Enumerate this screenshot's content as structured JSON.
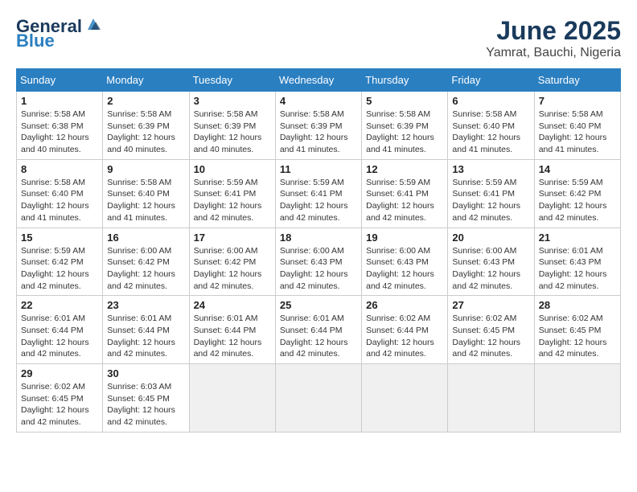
{
  "header": {
    "logo_general": "General",
    "logo_blue": "Blue",
    "month": "June 2025",
    "location": "Yamrat, Bauchi, Nigeria"
  },
  "days_of_week": [
    "Sunday",
    "Monday",
    "Tuesday",
    "Wednesday",
    "Thursday",
    "Friday",
    "Saturday"
  ],
  "weeks": [
    [
      {
        "day": "1",
        "info": "Sunrise: 5:58 AM\nSunset: 6:38 PM\nDaylight: 12 hours\nand 40 minutes."
      },
      {
        "day": "2",
        "info": "Sunrise: 5:58 AM\nSunset: 6:39 PM\nDaylight: 12 hours\nand 40 minutes."
      },
      {
        "day": "3",
        "info": "Sunrise: 5:58 AM\nSunset: 6:39 PM\nDaylight: 12 hours\nand 40 minutes."
      },
      {
        "day": "4",
        "info": "Sunrise: 5:58 AM\nSunset: 6:39 PM\nDaylight: 12 hours\nand 41 minutes."
      },
      {
        "day": "5",
        "info": "Sunrise: 5:58 AM\nSunset: 6:39 PM\nDaylight: 12 hours\nand 41 minutes."
      },
      {
        "day": "6",
        "info": "Sunrise: 5:58 AM\nSunset: 6:40 PM\nDaylight: 12 hours\nand 41 minutes."
      },
      {
        "day": "7",
        "info": "Sunrise: 5:58 AM\nSunset: 6:40 PM\nDaylight: 12 hours\nand 41 minutes."
      }
    ],
    [
      {
        "day": "8",
        "info": "Sunrise: 5:58 AM\nSunset: 6:40 PM\nDaylight: 12 hours\nand 41 minutes."
      },
      {
        "day": "9",
        "info": "Sunrise: 5:58 AM\nSunset: 6:40 PM\nDaylight: 12 hours\nand 41 minutes."
      },
      {
        "day": "10",
        "info": "Sunrise: 5:59 AM\nSunset: 6:41 PM\nDaylight: 12 hours\nand 42 minutes."
      },
      {
        "day": "11",
        "info": "Sunrise: 5:59 AM\nSunset: 6:41 PM\nDaylight: 12 hours\nand 42 minutes."
      },
      {
        "day": "12",
        "info": "Sunrise: 5:59 AM\nSunset: 6:41 PM\nDaylight: 12 hours\nand 42 minutes."
      },
      {
        "day": "13",
        "info": "Sunrise: 5:59 AM\nSunset: 6:41 PM\nDaylight: 12 hours\nand 42 minutes."
      },
      {
        "day": "14",
        "info": "Sunrise: 5:59 AM\nSunset: 6:42 PM\nDaylight: 12 hours\nand 42 minutes."
      }
    ],
    [
      {
        "day": "15",
        "info": "Sunrise: 5:59 AM\nSunset: 6:42 PM\nDaylight: 12 hours\nand 42 minutes."
      },
      {
        "day": "16",
        "info": "Sunrise: 6:00 AM\nSunset: 6:42 PM\nDaylight: 12 hours\nand 42 minutes."
      },
      {
        "day": "17",
        "info": "Sunrise: 6:00 AM\nSunset: 6:42 PM\nDaylight: 12 hours\nand 42 minutes."
      },
      {
        "day": "18",
        "info": "Sunrise: 6:00 AM\nSunset: 6:43 PM\nDaylight: 12 hours\nand 42 minutes."
      },
      {
        "day": "19",
        "info": "Sunrise: 6:00 AM\nSunset: 6:43 PM\nDaylight: 12 hours\nand 42 minutes."
      },
      {
        "day": "20",
        "info": "Sunrise: 6:00 AM\nSunset: 6:43 PM\nDaylight: 12 hours\nand 42 minutes."
      },
      {
        "day": "21",
        "info": "Sunrise: 6:01 AM\nSunset: 6:43 PM\nDaylight: 12 hours\nand 42 minutes."
      }
    ],
    [
      {
        "day": "22",
        "info": "Sunrise: 6:01 AM\nSunset: 6:44 PM\nDaylight: 12 hours\nand 42 minutes."
      },
      {
        "day": "23",
        "info": "Sunrise: 6:01 AM\nSunset: 6:44 PM\nDaylight: 12 hours\nand 42 minutes."
      },
      {
        "day": "24",
        "info": "Sunrise: 6:01 AM\nSunset: 6:44 PM\nDaylight: 12 hours\nand 42 minutes."
      },
      {
        "day": "25",
        "info": "Sunrise: 6:01 AM\nSunset: 6:44 PM\nDaylight: 12 hours\nand 42 minutes."
      },
      {
        "day": "26",
        "info": "Sunrise: 6:02 AM\nSunset: 6:44 PM\nDaylight: 12 hours\nand 42 minutes."
      },
      {
        "day": "27",
        "info": "Sunrise: 6:02 AM\nSunset: 6:45 PM\nDaylight: 12 hours\nand 42 minutes."
      },
      {
        "day": "28",
        "info": "Sunrise: 6:02 AM\nSunset: 6:45 PM\nDaylight: 12 hours\nand 42 minutes."
      }
    ],
    [
      {
        "day": "29",
        "info": "Sunrise: 6:02 AM\nSunset: 6:45 PM\nDaylight: 12 hours\nand 42 minutes."
      },
      {
        "day": "30",
        "info": "Sunrise: 6:03 AM\nSunset: 6:45 PM\nDaylight: 12 hours\nand 42 minutes."
      },
      {
        "day": "",
        "info": ""
      },
      {
        "day": "",
        "info": ""
      },
      {
        "day": "",
        "info": ""
      },
      {
        "day": "",
        "info": ""
      },
      {
        "day": "",
        "info": ""
      }
    ]
  ]
}
